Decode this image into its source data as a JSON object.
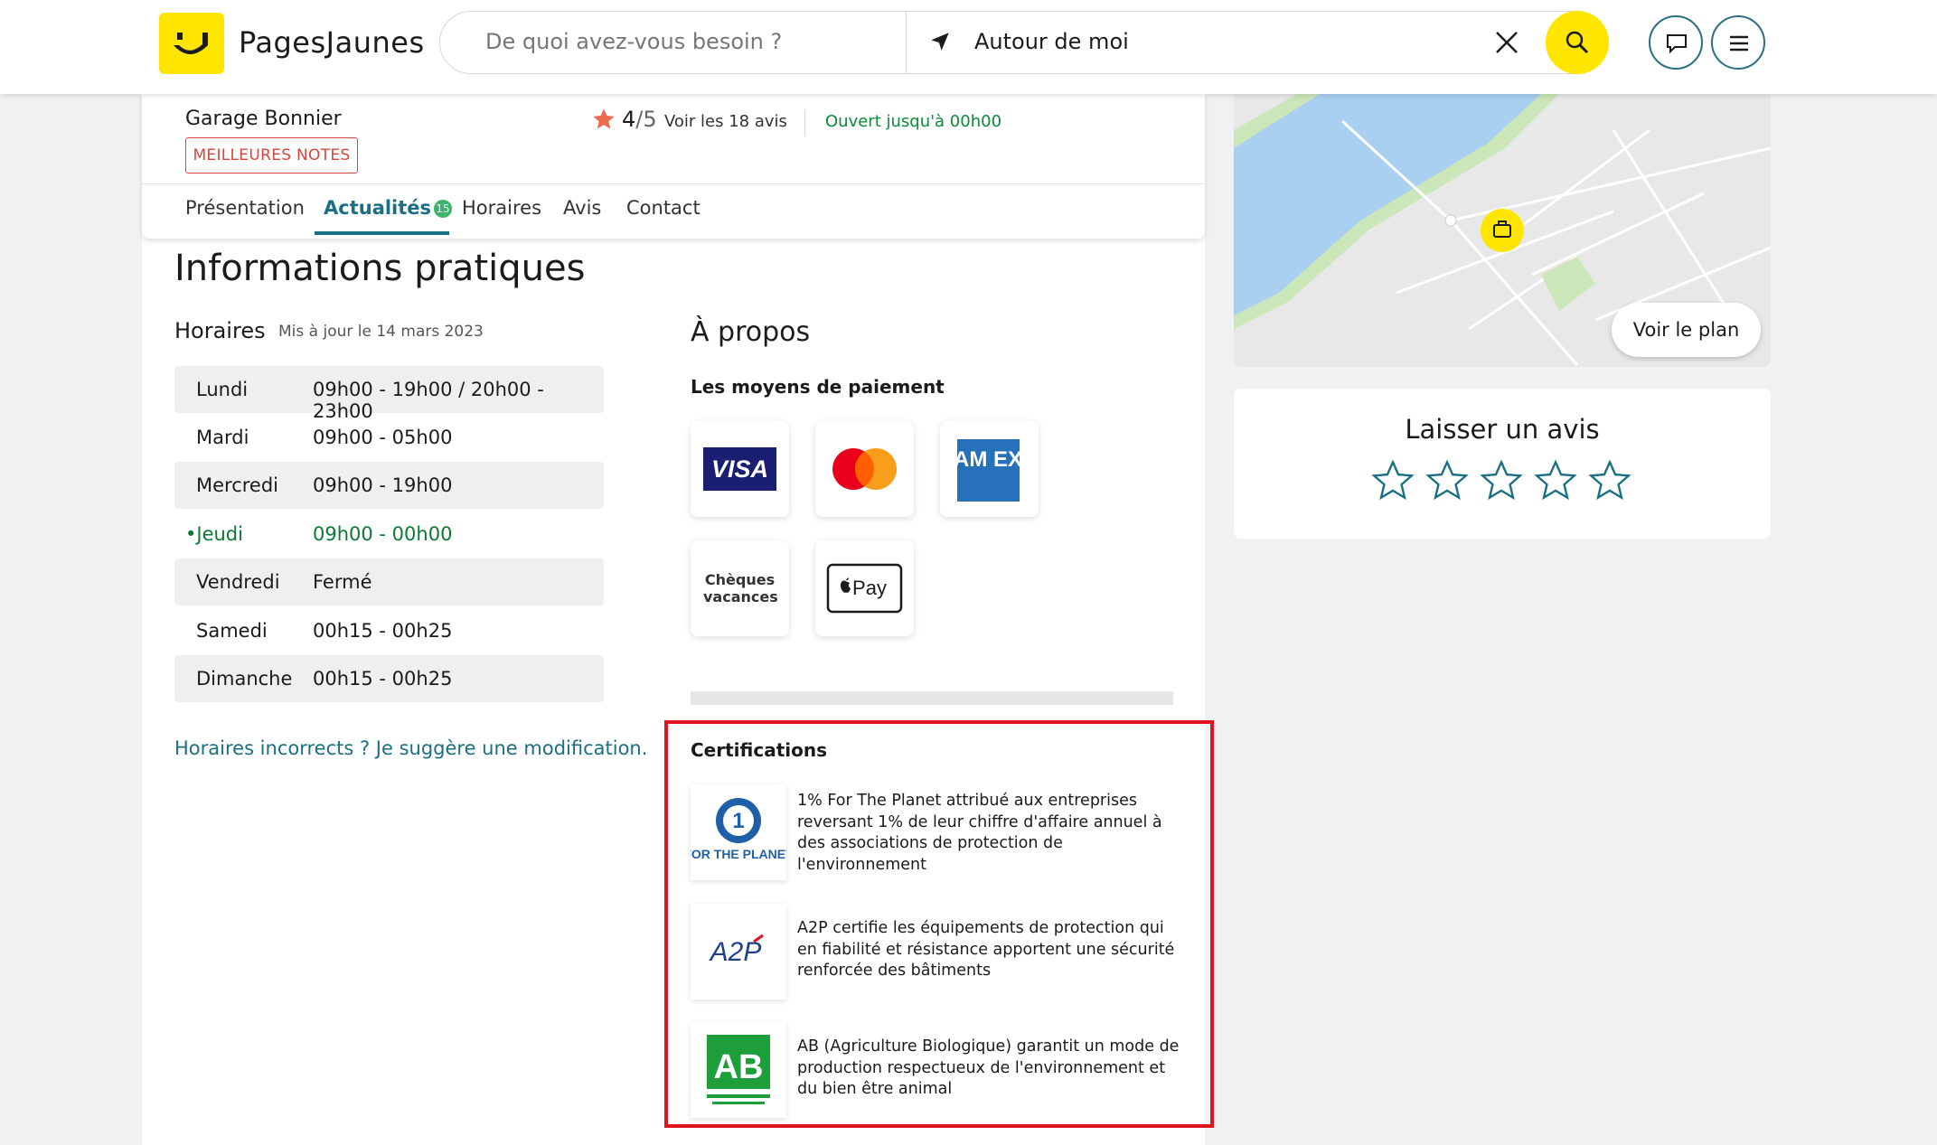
{
  "header": {
    "logo_text": "PagesJaunes",
    "search_what_placeholder": "De quoi avez-vous besoin ?",
    "search_where_value": "Autour de moi"
  },
  "business": {
    "name": "Garage Bonnier",
    "badge": "MEILLEURES NOTES",
    "rating_score": "4",
    "rating_max": "/5",
    "reviews_link": "Voir les 18 avis",
    "open_status": "Ouvert jusqu'à 00h00"
  },
  "tabs": [
    {
      "label": "Présentation"
    },
    {
      "label": "Actualités",
      "count": "15"
    },
    {
      "label": "Horaires"
    },
    {
      "label": "Avis"
    },
    {
      "label": "Contact"
    }
  ],
  "practical": {
    "title": "Informations pratiques",
    "hours_title": "Horaires",
    "hours_updated": "Mis à jour le 14 mars 2023",
    "hours": [
      {
        "day": "Lundi",
        "value": "09h00 - 19h00 / 20h00 - 23h00"
      },
      {
        "day": "Mardi",
        "value": "09h00 - 05h00"
      },
      {
        "day": "Mercredi",
        "value": "09h00 - 19h00"
      },
      {
        "day": "•Jeudi",
        "value": "09h00 - 00h00"
      },
      {
        "day": "Vendredi",
        "value": "Fermé"
      },
      {
        "day": "Samedi",
        "value": "00h15 - 00h25"
      },
      {
        "day": "Dimanche",
        "value": "00h15 - 00h25"
      }
    ],
    "hours_suggest": "Horaires incorrects ? Je suggère une modification."
  },
  "about": {
    "title": "À propos",
    "payments_title": "Les moyens de paiement",
    "payments": [
      {
        "name": "visa-logo",
        "label": "VISA"
      },
      {
        "name": "mastercard-logo",
        "label": ""
      },
      {
        "name": "amex-logo",
        "label": "AM EX"
      },
      {
        "name": "cheques-vacances-logo",
        "label": "Chèques vacances"
      },
      {
        "name": "apple-pay-logo",
        "label": "Pay"
      }
    ],
    "certifications_title": "Certifications",
    "certifications": [
      {
        "icon": "one-percent-for-the-planet-logo",
        "logo_text": "FOR THE PLANET",
        "text": "1% For The Planet attribué aux entreprises reversant 1% de leur chiffre d'affaire annuel à des associations de protection de l'environnement"
      },
      {
        "icon": "a2p-logo",
        "logo_text": "A2P",
        "text": "A2P certifie les équipements de protection qui en fiabilité et résistance apportent une sécurité renforcée des bâtiments"
      },
      {
        "icon": "agriculture-biologique-logo",
        "logo_text": "AB",
        "text": "AB (Agriculture Biologique) garantit un mode de production respectueux de l'environnement et du bien être animal"
      }
    ]
  },
  "map": {
    "button": "Voir le plan"
  },
  "review": {
    "title": "Laisser un avis",
    "stars": 5
  },
  "colors": {
    "brand_yellow": "#ffe500",
    "accent_teal": "#1a6f84",
    "open_green": "#0a8a3a",
    "highlight_red": "#e0141e"
  }
}
